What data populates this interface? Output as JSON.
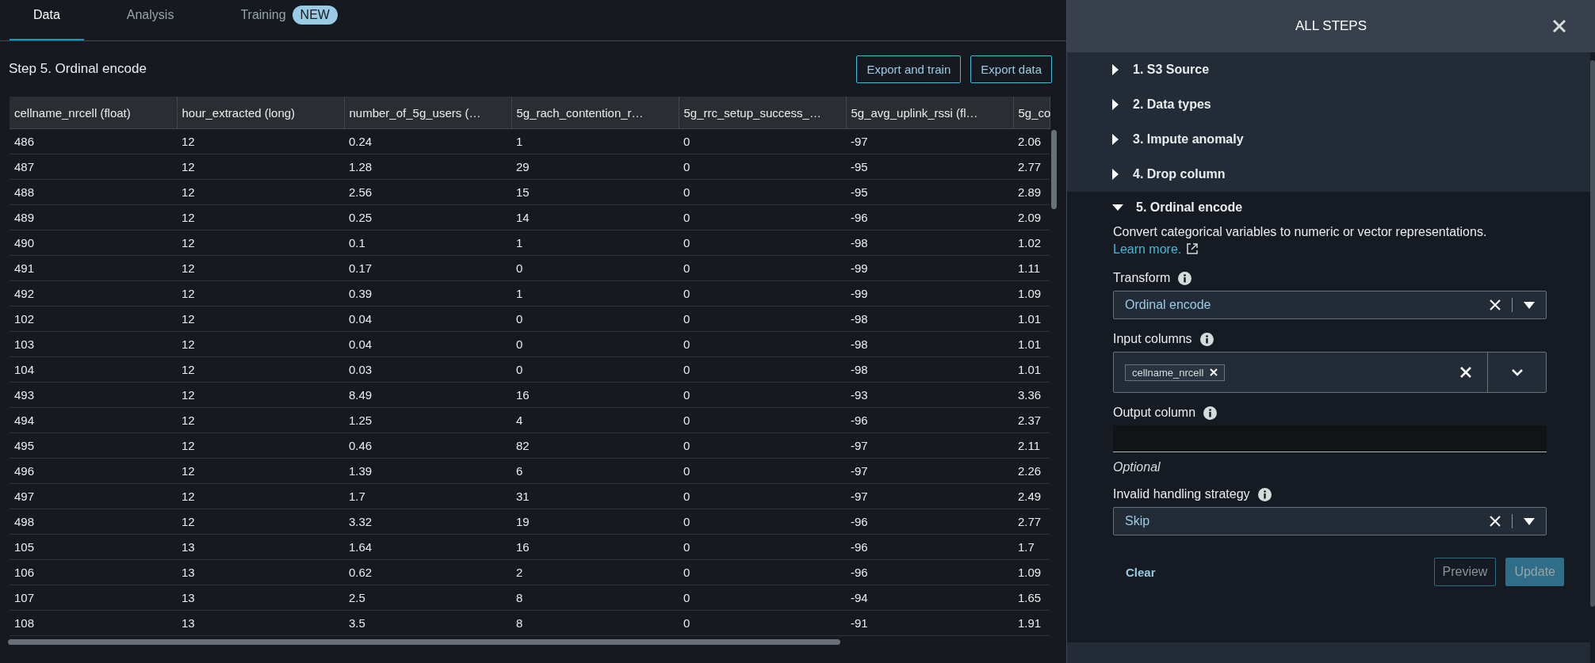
{
  "tabs": [
    {
      "label": "Data",
      "selected": true
    },
    {
      "label": "Analysis",
      "selected": false
    },
    {
      "label": "Training",
      "selected": false,
      "badge": "NEW"
    }
  ],
  "step_title": "Step 5. Ordinal encode",
  "buttons": [
    "Export and train",
    "Export data"
  ],
  "table": {
    "columns": [
      "cellname_nrcell (float)",
      "hour_extracted (long)",
      "number_of_5g_users (…",
      "5g_rach_contention_r…",
      "5g_rrc_setup_success_…",
      "5g_avg_uplink_rssi (fl…",
      "5g_co"
    ],
    "rows": [
      [
        "486",
        "12",
        "0.24",
        "1",
        "0",
        "-97",
        "2.06"
      ],
      [
        "487",
        "12",
        "1.28",
        "29",
        "0",
        "-95",
        "2.77"
      ],
      [
        "488",
        "12",
        "2.56",
        "15",
        "0",
        "-95",
        "2.89"
      ],
      [
        "489",
        "12",
        "0.25",
        "14",
        "0",
        "-96",
        "2.09"
      ],
      [
        "490",
        "12",
        "0.1",
        "1",
        "0",
        "-98",
        "1.02"
      ],
      [
        "491",
        "12",
        "0.17",
        "0",
        "0",
        "-99",
        "1.11"
      ],
      [
        "492",
        "12",
        "0.39",
        "1",
        "0",
        "-99",
        "1.09"
      ],
      [
        "102",
        "12",
        "0.04",
        "0",
        "0",
        "-98",
        "1.01"
      ],
      [
        "103",
        "12",
        "0.04",
        "0",
        "0",
        "-98",
        "1.01"
      ],
      [
        "104",
        "12",
        "0.03",
        "0",
        "0",
        "-98",
        "1.01"
      ],
      [
        "493",
        "12",
        "8.49",
        "16",
        "0",
        "-93",
        "3.36"
      ],
      [
        "494",
        "12",
        "1.25",
        "4",
        "0",
        "-96",
        "2.37"
      ],
      [
        "495",
        "12",
        "0.46",
        "82",
        "0",
        "-97",
        "2.11"
      ],
      [
        "496",
        "12",
        "1.39",
        "6",
        "0",
        "-97",
        "2.26"
      ],
      [
        "497",
        "12",
        "1.7",
        "31",
        "0",
        "-97",
        "2.49"
      ],
      [
        "498",
        "12",
        "3.32",
        "19",
        "0",
        "-96",
        "2.77"
      ],
      [
        "105",
        "13",
        "1.64",
        "16",
        "0",
        "-96",
        "1.7"
      ],
      [
        "106",
        "13",
        "0.62",
        "2",
        "0",
        "-96",
        "1.09"
      ],
      [
        "107",
        "13",
        "2.5",
        "8",
        "0",
        "-94",
        "1.65"
      ],
      [
        "108",
        "13",
        "3.5",
        "8",
        "0",
        "-91",
        "1.91"
      ]
    ]
  },
  "panel": {
    "title": "ALL STEPS",
    "steps": [
      {
        "label": "1. S3 Source",
        "expanded": false
      },
      {
        "label": "2. Data types",
        "expanded": false
      },
      {
        "label": "3. Impute anomaly",
        "expanded": false
      },
      {
        "label": "4. Drop column",
        "expanded": false
      },
      {
        "label": "5. Ordinal encode",
        "expanded": true
      }
    ],
    "description": "Convert categorical variables to numeric or vector representations.",
    "link": "Learn more.",
    "fields": [
      {
        "kind": "select",
        "label": "Transform",
        "value": "Ordinal encode"
      },
      {
        "kind": "multiselect",
        "label": "Input columns",
        "tokens": [
          "cellname_nrcell"
        ]
      },
      {
        "kind": "text",
        "label": "Output column",
        "hint": "Optional"
      },
      {
        "kind": "select",
        "label": "Invalid handling strategy",
        "value": "Skip"
      }
    ],
    "clear": "Clear",
    "actions": [
      {
        "label": "Preview",
        "kind": "secondary",
        "disabled": true
      },
      {
        "label": "Update",
        "kind": "primary",
        "disabled": true
      }
    ]
  }
}
